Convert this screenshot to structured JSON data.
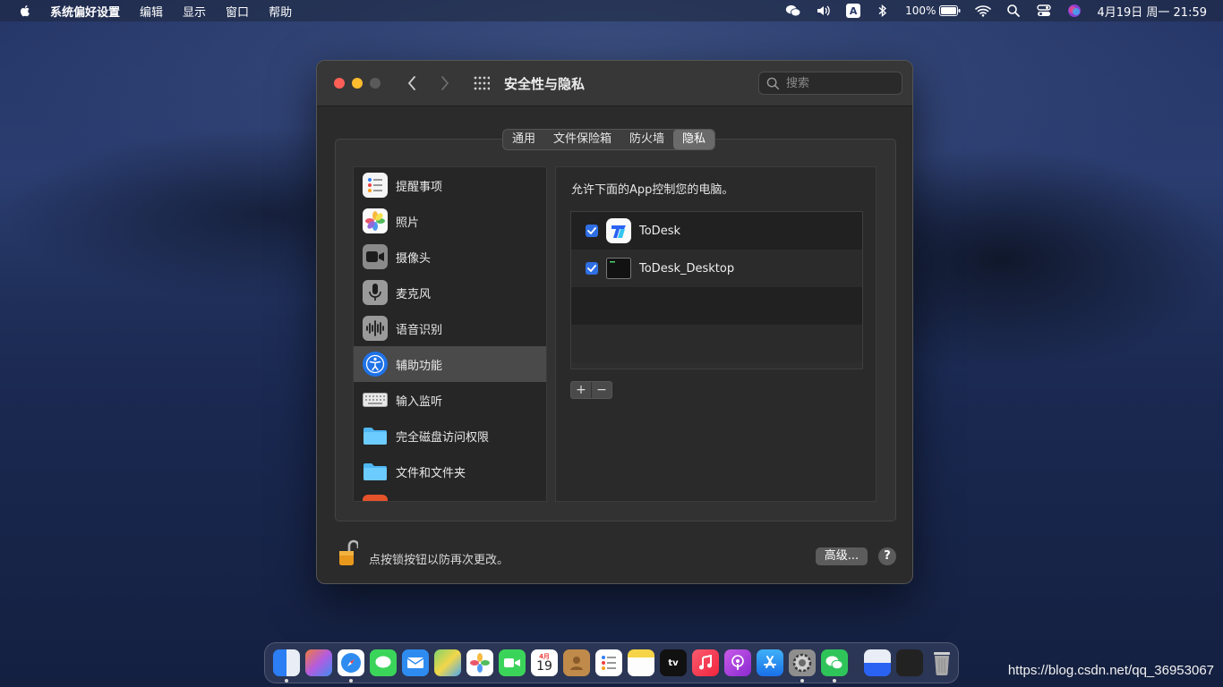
{
  "menubar": {
    "app_name": "系统偏好设置",
    "menus": [
      "编辑",
      "显示",
      "窗口",
      "帮助"
    ],
    "battery": "100%",
    "datetime": "4月19日 周一  21:59",
    "input_method": "A"
  },
  "window": {
    "title": "安全性与隐私",
    "search_placeholder": "搜索",
    "tabs": [
      "通用",
      "文件保险箱",
      "防火墙",
      "隐私"
    ],
    "active_tab": "隐私",
    "sidebar": [
      {
        "label": "提醒事项",
        "icon": "reminders-icon"
      },
      {
        "label": "照片",
        "icon": "photos-icon"
      },
      {
        "label": "摄像头",
        "icon": "camera-icon"
      },
      {
        "label": "麦克风",
        "icon": "microphone-icon"
      },
      {
        "label": "语音识别",
        "icon": "speech-recognition-icon"
      },
      {
        "label": "辅助功能",
        "icon": "accessibility-icon",
        "selected": true
      },
      {
        "label": "输入监听",
        "icon": "keyboard-icon"
      },
      {
        "label": "完全磁盘访问权限",
        "icon": "folder-icon"
      },
      {
        "label": "文件和文件夹",
        "icon": "folder-icon"
      }
    ],
    "allow_text": "允许下面的App控制您的电脑。",
    "apps": [
      {
        "name": "ToDesk",
        "checked": true
      },
      {
        "name": "ToDesk_Desktop",
        "checked": true
      }
    ],
    "add_label": "+",
    "remove_label": "−",
    "lock_text": "点按锁按钮以防再次更改。",
    "advanced_label": "高级...",
    "help_label": "?"
  },
  "dock": {
    "calendar_month": "4月",
    "calendar_day": "19",
    "tv_label": "tv"
  },
  "watermark": "https://blog.csdn.net/qq_36953067",
  "colors": {
    "accent": "#2f6fe4",
    "close": "#ff5f57",
    "minimize": "#febc2e"
  }
}
